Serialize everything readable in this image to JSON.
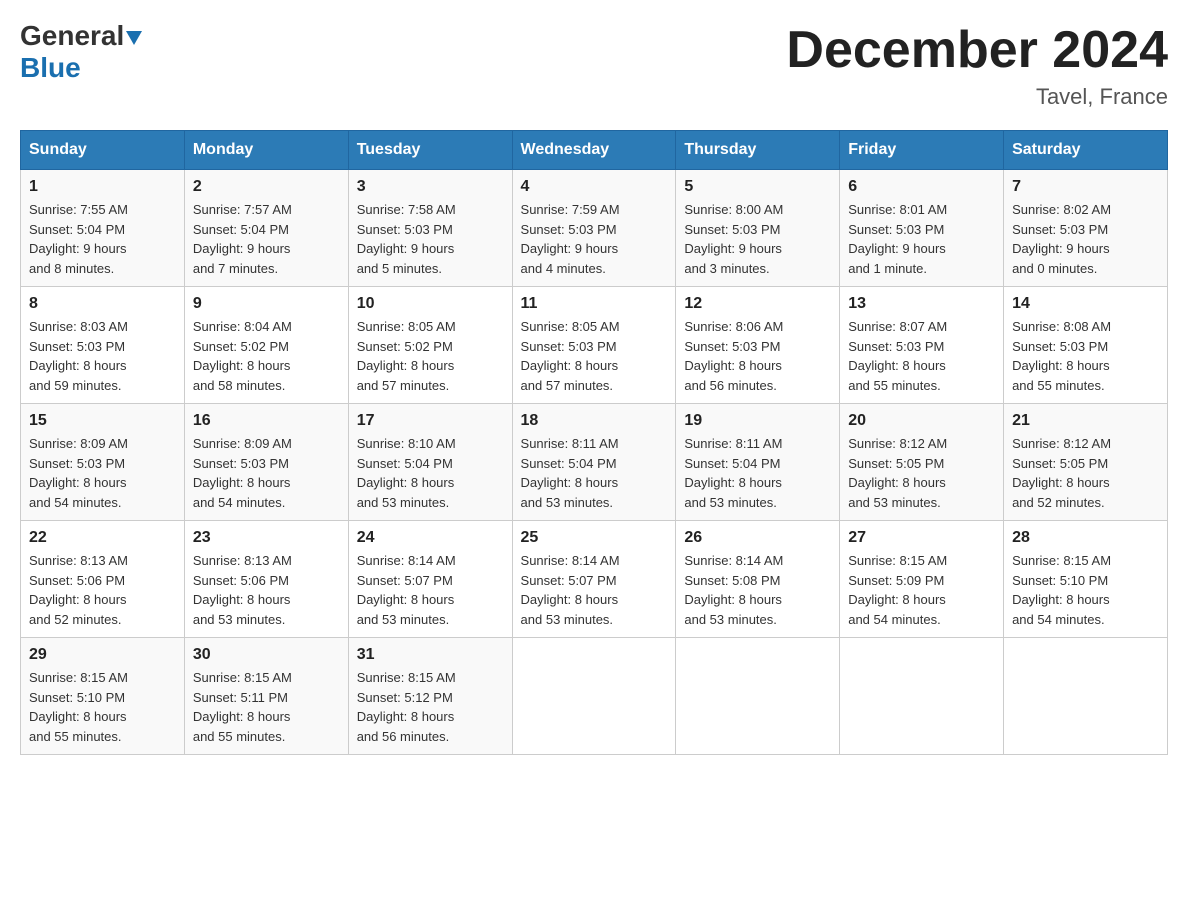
{
  "header": {
    "logo": {
      "general": "General",
      "blue": "Blue",
      "triangle": "▼"
    },
    "title": "December 2024",
    "location": "Tavel, France"
  },
  "days_of_week": [
    "Sunday",
    "Monday",
    "Tuesday",
    "Wednesday",
    "Thursday",
    "Friday",
    "Saturday"
  ],
  "weeks": [
    [
      {
        "day": "1",
        "sunrise": "7:55 AM",
        "sunset": "5:04 PM",
        "daylight": "9 hours and 8 minutes."
      },
      {
        "day": "2",
        "sunrise": "7:57 AM",
        "sunset": "5:04 PM",
        "daylight": "9 hours and 7 minutes."
      },
      {
        "day": "3",
        "sunrise": "7:58 AM",
        "sunset": "5:03 PM",
        "daylight": "9 hours and 5 minutes."
      },
      {
        "day": "4",
        "sunrise": "7:59 AM",
        "sunset": "5:03 PM",
        "daylight": "9 hours and 4 minutes."
      },
      {
        "day": "5",
        "sunrise": "8:00 AM",
        "sunset": "5:03 PM",
        "daylight": "9 hours and 3 minutes."
      },
      {
        "day": "6",
        "sunrise": "8:01 AM",
        "sunset": "5:03 PM",
        "daylight": "9 hours and 1 minute."
      },
      {
        "day": "7",
        "sunrise": "8:02 AM",
        "sunset": "5:03 PM",
        "daylight": "9 hours and 0 minutes."
      }
    ],
    [
      {
        "day": "8",
        "sunrise": "8:03 AM",
        "sunset": "5:03 PM",
        "daylight": "8 hours and 59 minutes."
      },
      {
        "day": "9",
        "sunrise": "8:04 AM",
        "sunset": "5:02 PM",
        "daylight": "8 hours and 58 minutes."
      },
      {
        "day": "10",
        "sunrise": "8:05 AM",
        "sunset": "5:02 PM",
        "daylight": "8 hours and 57 minutes."
      },
      {
        "day": "11",
        "sunrise": "8:05 AM",
        "sunset": "5:03 PM",
        "daylight": "8 hours and 57 minutes."
      },
      {
        "day": "12",
        "sunrise": "8:06 AM",
        "sunset": "5:03 PM",
        "daylight": "8 hours and 56 minutes."
      },
      {
        "day": "13",
        "sunrise": "8:07 AM",
        "sunset": "5:03 PM",
        "daylight": "8 hours and 55 minutes."
      },
      {
        "day": "14",
        "sunrise": "8:08 AM",
        "sunset": "5:03 PM",
        "daylight": "8 hours and 55 minutes."
      }
    ],
    [
      {
        "day": "15",
        "sunrise": "8:09 AM",
        "sunset": "5:03 PM",
        "daylight": "8 hours and 54 minutes."
      },
      {
        "day": "16",
        "sunrise": "8:09 AM",
        "sunset": "5:03 PM",
        "daylight": "8 hours and 54 minutes."
      },
      {
        "day": "17",
        "sunrise": "8:10 AM",
        "sunset": "5:04 PM",
        "daylight": "8 hours and 53 minutes."
      },
      {
        "day": "18",
        "sunrise": "8:11 AM",
        "sunset": "5:04 PM",
        "daylight": "8 hours and 53 minutes."
      },
      {
        "day": "19",
        "sunrise": "8:11 AM",
        "sunset": "5:04 PM",
        "daylight": "8 hours and 53 minutes."
      },
      {
        "day": "20",
        "sunrise": "8:12 AM",
        "sunset": "5:05 PM",
        "daylight": "8 hours and 53 minutes."
      },
      {
        "day": "21",
        "sunrise": "8:12 AM",
        "sunset": "5:05 PM",
        "daylight": "8 hours and 52 minutes."
      }
    ],
    [
      {
        "day": "22",
        "sunrise": "8:13 AM",
        "sunset": "5:06 PM",
        "daylight": "8 hours and 52 minutes."
      },
      {
        "day": "23",
        "sunrise": "8:13 AM",
        "sunset": "5:06 PM",
        "daylight": "8 hours and 53 minutes."
      },
      {
        "day": "24",
        "sunrise": "8:14 AM",
        "sunset": "5:07 PM",
        "daylight": "8 hours and 53 minutes."
      },
      {
        "day": "25",
        "sunrise": "8:14 AM",
        "sunset": "5:07 PM",
        "daylight": "8 hours and 53 minutes."
      },
      {
        "day": "26",
        "sunrise": "8:14 AM",
        "sunset": "5:08 PM",
        "daylight": "8 hours and 53 minutes."
      },
      {
        "day": "27",
        "sunrise": "8:15 AM",
        "sunset": "5:09 PM",
        "daylight": "8 hours and 54 minutes."
      },
      {
        "day": "28",
        "sunrise": "8:15 AM",
        "sunset": "5:10 PM",
        "daylight": "8 hours and 54 minutes."
      }
    ],
    [
      {
        "day": "29",
        "sunrise": "8:15 AM",
        "sunset": "5:10 PM",
        "daylight": "8 hours and 55 minutes."
      },
      {
        "day": "30",
        "sunrise": "8:15 AM",
        "sunset": "5:11 PM",
        "daylight": "8 hours and 55 minutes."
      },
      {
        "day": "31",
        "sunrise": "8:15 AM",
        "sunset": "5:12 PM",
        "daylight": "8 hours and 56 minutes."
      },
      null,
      null,
      null,
      null
    ]
  ],
  "labels": {
    "sunrise": "Sunrise:",
    "sunset": "Sunset:",
    "daylight": "Daylight:"
  }
}
